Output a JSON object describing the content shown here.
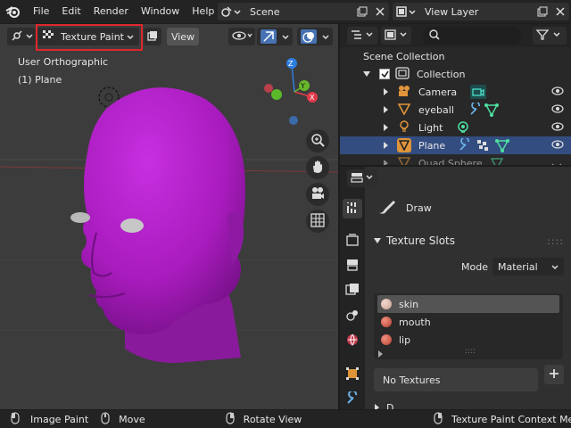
{
  "topbar": {
    "menus": [
      "File",
      "Edit",
      "Render",
      "Window",
      "Help"
    ],
    "scene_name": "Scene",
    "view_layer_name": "View Layer"
  },
  "viewport": {
    "mode_label": "Texture Paint",
    "view_menu": "View",
    "view_name": "User Orthographic",
    "object_label": "(1) Plane",
    "gizmo_axes": {
      "z": "Z",
      "y": "Y",
      "x": "X"
    },
    "colors": {
      "mesh": "#a81bbd",
      "mode_highlight": "#e0272c"
    }
  },
  "outliner": {
    "search_placeholder": "",
    "scene_collection": "Scene Collection",
    "items": [
      {
        "label": "Collection"
      },
      {
        "label": "Camera"
      },
      {
        "label": "eyeball"
      },
      {
        "label": "Light"
      },
      {
        "label": "Plane"
      },
      {
        "label": "Quad Sphere"
      }
    ]
  },
  "properties": {
    "brush_name": "Draw",
    "section_title": "Texture Slots",
    "mode_label": "Mode",
    "mode_value": "Material",
    "slots": [
      "skin",
      "mouth",
      "lip"
    ],
    "no_textures": "No Textures",
    "next_section_partial": "D"
  },
  "statusbar": {
    "left": "Image Paint",
    "move": "Move",
    "rotate": "Rotate View",
    "right": "Texture Paint Context Menu"
  }
}
